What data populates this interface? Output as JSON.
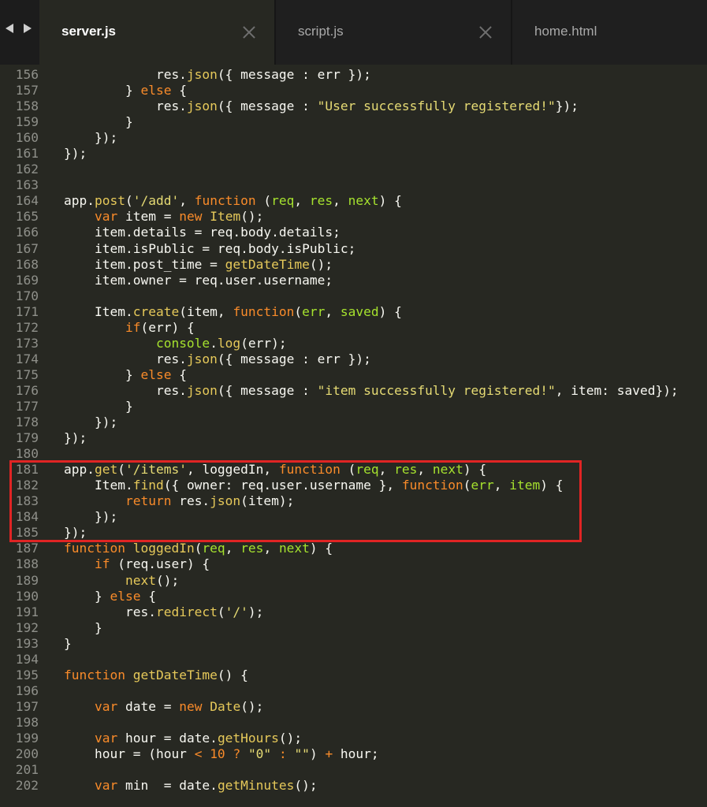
{
  "tabs": [
    {
      "label": "server.js",
      "active": true,
      "closable": true
    },
    {
      "label": "script.js",
      "active": false,
      "closable": true
    },
    {
      "label": "home.html",
      "active": false,
      "closable": false
    }
  ],
  "navigation": {
    "back_icon": "chevron-left-icon",
    "forward_icon": "chevron-right-icon"
  },
  "colors": {
    "background": "#272822",
    "tab_bar": "#1c1c1c",
    "keyword": "#f98b2a",
    "function": "#e6c95a",
    "string": "#e6db74",
    "parameter": "#a6e22e",
    "plain": "#f8f8f2",
    "line_number": "#8f908a",
    "highlight_border": "#e02424"
  },
  "highlight": {
    "from_line": "181",
    "to_line": "185"
  },
  "code_lines": [
    {
      "num": "156",
      "tokens": [
        [
          "",
          "            res."
        ],
        [
          "fn",
          "json"
        ],
        [
          "",
          "({ message : err });"
        ]
      ]
    },
    {
      "num": "157",
      "tokens": [
        [
          "",
          "        } "
        ],
        [
          "kw",
          "else"
        ],
        [
          "",
          " {"
        ]
      ]
    },
    {
      "num": "158",
      "tokens": [
        [
          "",
          "            res."
        ],
        [
          "fn",
          "json"
        ],
        [
          "",
          "({ message : "
        ],
        [
          "str",
          "\"User successfully registered!\""
        ],
        [
          "",
          "});"
        ]
      ]
    },
    {
      "num": "159",
      "tokens": [
        [
          "",
          "        }"
        ]
      ]
    },
    {
      "num": "160",
      "tokens": [
        [
          "",
          "    });"
        ]
      ]
    },
    {
      "num": "161",
      "tokens": [
        [
          "",
          "});"
        ]
      ]
    },
    {
      "num": "162",
      "tokens": []
    },
    {
      "num": "163",
      "tokens": []
    },
    {
      "num": "164",
      "tokens": [
        [
          "",
          "app."
        ],
        [
          "fn",
          "post"
        ],
        [
          "",
          "("
        ],
        [
          "str",
          "'/add'"
        ],
        [
          "",
          ", "
        ],
        [
          "kw",
          "function"
        ],
        [
          "",
          " ("
        ],
        [
          "prm",
          "req"
        ],
        [
          "",
          ", "
        ],
        [
          "prm",
          "res"
        ],
        [
          "",
          ", "
        ],
        [
          "prm",
          "next"
        ],
        [
          "",
          ") {"
        ]
      ]
    },
    {
      "num": "165",
      "tokens": [
        [
          "",
          "    "
        ],
        [
          "kw",
          "var"
        ],
        [
          "",
          " item = "
        ],
        [
          "kw",
          "new"
        ],
        [
          "",
          " "
        ],
        [
          "fn",
          "Item"
        ],
        [
          "",
          "();"
        ]
      ]
    },
    {
      "num": "166",
      "tokens": [
        [
          "",
          "    item.details = req.body.details;"
        ]
      ]
    },
    {
      "num": "167",
      "tokens": [
        [
          "",
          "    item.isPublic = req.body.isPublic;"
        ]
      ]
    },
    {
      "num": "168",
      "tokens": [
        [
          "",
          "    item.post_time = "
        ],
        [
          "fn",
          "getDateTime"
        ],
        [
          "",
          "();"
        ]
      ]
    },
    {
      "num": "169",
      "tokens": [
        [
          "",
          "    item.owner = req.user.username;"
        ]
      ]
    },
    {
      "num": "170",
      "tokens": []
    },
    {
      "num": "171",
      "tokens": [
        [
          "",
          "    Item."
        ],
        [
          "fn",
          "create"
        ],
        [
          "",
          "(item, "
        ],
        [
          "kw",
          "function"
        ],
        [
          "",
          "("
        ],
        [
          "prm",
          "err"
        ],
        [
          "",
          ", "
        ],
        [
          "prm",
          "saved"
        ],
        [
          "",
          ") {"
        ]
      ]
    },
    {
      "num": "172",
      "tokens": [
        [
          "",
          "        "
        ],
        [
          "kw",
          "if"
        ],
        [
          "",
          "(err) {"
        ]
      ]
    },
    {
      "num": "173",
      "tokens": [
        [
          "",
          "            "
        ],
        [
          "prm",
          "console"
        ],
        [
          "",
          "."
        ],
        [
          "fn",
          "log"
        ],
        [
          "",
          "(err);"
        ]
      ]
    },
    {
      "num": "174",
      "tokens": [
        [
          "",
          "            res."
        ],
        [
          "fn",
          "json"
        ],
        [
          "",
          "({ message : err });"
        ]
      ]
    },
    {
      "num": "175",
      "tokens": [
        [
          "",
          "        } "
        ],
        [
          "kw",
          "else"
        ],
        [
          "",
          " {"
        ]
      ]
    },
    {
      "num": "176",
      "tokens": [
        [
          "",
          "            res."
        ],
        [
          "fn",
          "json"
        ],
        [
          "",
          "({ message : "
        ],
        [
          "str",
          "\"item successfully registered!\""
        ],
        [
          "",
          ", item: saved});"
        ]
      ]
    },
    {
      "num": "177",
      "tokens": [
        [
          "",
          "        }"
        ]
      ]
    },
    {
      "num": "178",
      "tokens": [
        [
          "",
          "    });"
        ]
      ]
    },
    {
      "num": "179",
      "tokens": [
        [
          "",
          "});"
        ]
      ]
    },
    {
      "num": "180",
      "tokens": []
    },
    {
      "num": "181",
      "tokens": [
        [
          "",
          "app."
        ],
        [
          "fn",
          "get"
        ],
        [
          "",
          "("
        ],
        [
          "str",
          "'/items'"
        ],
        [
          "",
          ", loggedIn, "
        ],
        [
          "kw",
          "function"
        ],
        [
          "",
          " ("
        ],
        [
          "prm",
          "req"
        ],
        [
          "",
          ", "
        ],
        [
          "prm",
          "res"
        ],
        [
          "",
          ", "
        ],
        [
          "prm",
          "next"
        ],
        [
          "",
          ") {"
        ]
      ]
    },
    {
      "num": "182",
      "tokens": [
        [
          "",
          "    Item."
        ],
        [
          "fn",
          "find"
        ],
        [
          "",
          "({ owner: req.user.username }, "
        ],
        [
          "kw",
          "function"
        ],
        [
          "",
          "("
        ],
        [
          "prm",
          "err"
        ],
        [
          "",
          ", "
        ],
        [
          "prm",
          "item"
        ],
        [
          "",
          ") {"
        ]
      ]
    },
    {
      "num": "183",
      "tokens": [
        [
          "",
          "        "
        ],
        [
          "kw",
          "return"
        ],
        [
          "",
          " res."
        ],
        [
          "fn",
          "json"
        ],
        [
          "",
          "(item);"
        ]
      ]
    },
    {
      "num": "184",
      "tokens": [
        [
          "",
          "    });"
        ]
      ]
    },
    {
      "num": "185",
      "tokens": [
        [
          "",
          "});"
        ]
      ]
    },
    {
      "num": "187",
      "tokens": [
        [
          "kw",
          "function"
        ],
        [
          "",
          " "
        ],
        [
          "fn",
          "loggedIn"
        ],
        [
          "",
          "("
        ],
        [
          "prm",
          "req"
        ],
        [
          "",
          ", "
        ],
        [
          "prm",
          "res"
        ],
        [
          "",
          ", "
        ],
        [
          "prm",
          "next"
        ],
        [
          "",
          ") {"
        ]
      ]
    },
    {
      "num": "188",
      "tokens": [
        [
          "",
          "    "
        ],
        [
          "kw",
          "if"
        ],
        [
          "",
          " (req.user) {"
        ]
      ]
    },
    {
      "num": "189",
      "tokens": [
        [
          "",
          "        "
        ],
        [
          "fn",
          "next"
        ],
        [
          "",
          "();"
        ]
      ]
    },
    {
      "num": "190",
      "tokens": [
        [
          "",
          "    } "
        ],
        [
          "kw",
          "else"
        ],
        [
          "",
          " {"
        ]
      ]
    },
    {
      "num": "191",
      "tokens": [
        [
          "",
          "        res."
        ],
        [
          "fn",
          "redirect"
        ],
        [
          "",
          "("
        ],
        [
          "str",
          "'/'"
        ],
        [
          "",
          ");"
        ]
      ]
    },
    {
      "num": "192",
      "tokens": [
        [
          "",
          "    }"
        ]
      ]
    },
    {
      "num": "193",
      "tokens": [
        [
          "",
          "}"
        ]
      ]
    },
    {
      "num": "194",
      "tokens": []
    },
    {
      "num": "195",
      "tokens": [
        [
          "kw",
          "function"
        ],
        [
          "",
          " "
        ],
        [
          "fn",
          "getDateTime"
        ],
        [
          "",
          "() {"
        ]
      ]
    },
    {
      "num": "196",
      "tokens": []
    },
    {
      "num": "197",
      "tokens": [
        [
          "",
          "    "
        ],
        [
          "kw",
          "var"
        ],
        [
          "",
          " date = "
        ],
        [
          "kw",
          "new"
        ],
        [
          "",
          " "
        ],
        [
          "fn",
          "Date"
        ],
        [
          "",
          "();"
        ]
      ]
    },
    {
      "num": "198",
      "tokens": []
    },
    {
      "num": "199",
      "tokens": [
        [
          "",
          "    "
        ],
        [
          "kw",
          "var"
        ],
        [
          "",
          " hour = date."
        ],
        [
          "fn",
          "getHours"
        ],
        [
          "",
          "();"
        ]
      ]
    },
    {
      "num": "200",
      "tokens": [
        [
          "",
          "    hour = (hour "
        ],
        [
          "kw",
          "<"
        ],
        [
          "",
          " "
        ],
        [
          "kw",
          "10"
        ],
        [
          "",
          " "
        ],
        [
          "kw",
          "?"
        ],
        [
          "",
          " "
        ],
        [
          "str",
          "\"0\""
        ],
        [
          "",
          " "
        ],
        [
          "kw",
          ":"
        ],
        [
          "",
          " "
        ],
        [
          "str",
          "\"\""
        ],
        [
          "",
          ") "
        ],
        [
          "kw",
          "+"
        ],
        [
          "",
          " hour;"
        ]
      ]
    },
    {
      "num": "201",
      "tokens": []
    },
    {
      "num": "202",
      "tokens": [
        [
          "",
          "    "
        ],
        [
          "kw",
          "var"
        ],
        [
          "",
          " min  = date."
        ],
        [
          "fn",
          "getMinutes"
        ],
        [
          "",
          "();"
        ]
      ]
    }
  ]
}
